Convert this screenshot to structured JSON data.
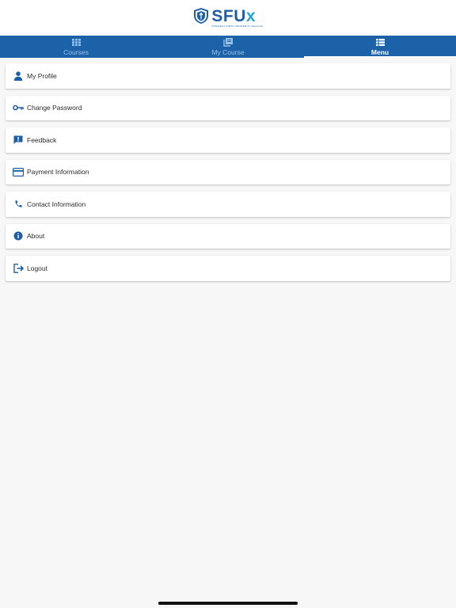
{
  "brand": {
    "name_main": "SFU",
    "name_accent": "x",
    "subtitle": "STRATEGY FIRST UNIVERSITY Extension",
    "primary_color": "#1b62a8",
    "accent_color": "#2aa3d9"
  },
  "tabs": [
    {
      "label": "Courses",
      "icon": "grid-icon",
      "active": false
    },
    {
      "label": "My Course",
      "icon": "book-stack-icon",
      "active": false
    },
    {
      "label": "Menu",
      "icon": "list-icon",
      "active": true
    }
  ],
  "menu": {
    "items": [
      {
        "label": "My Profile",
        "icon": "person-icon"
      },
      {
        "label": "Change Password",
        "icon": "key-icon"
      },
      {
        "label": "Feedback",
        "icon": "feedback-icon"
      },
      {
        "label": "Payment Information",
        "icon": "credit-card-icon"
      },
      {
        "label": "Contact Information",
        "icon": "phone-icon"
      },
      {
        "label": "About",
        "icon": "info-icon"
      },
      {
        "label": "Logout",
        "icon": "logout-icon"
      }
    ]
  }
}
